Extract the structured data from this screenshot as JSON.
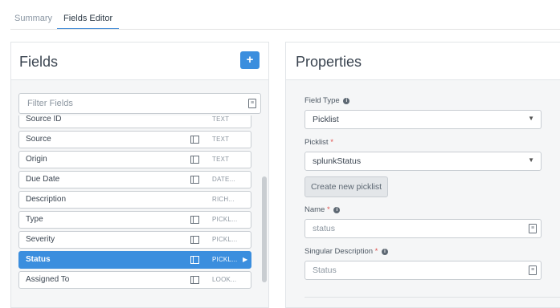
{
  "tabs": {
    "summary": "Summary",
    "fields_editor": "Fields Editor"
  },
  "fields": {
    "title": "Fields",
    "add_label": "+",
    "filter_placeholder": "Filter Fields",
    "rows": [
      {
        "name": "Source ID",
        "type": "TEXT",
        "icon": "table-icon",
        "has_icon": false
      },
      {
        "name": "Source",
        "type": "TEXT",
        "icon": "table-icon",
        "has_icon": true
      },
      {
        "name": "Origin",
        "type": "TEXT",
        "icon": "table-icon",
        "has_icon": true
      },
      {
        "name": "Due Date",
        "type": "DATE...",
        "icon": "table-icon",
        "has_icon": true
      },
      {
        "name": "Description",
        "type": "RICH...",
        "icon": "table-icon",
        "has_icon": false
      },
      {
        "name": "Type",
        "type": "PICKL...",
        "icon": "table-icon",
        "has_icon": true
      },
      {
        "name": "Severity",
        "type": "PICKL...",
        "icon": "table-icon",
        "has_icon": true
      },
      {
        "name": "Status",
        "type": "PICKL...",
        "icon": "table-icon",
        "has_icon": true,
        "selected": true
      },
      {
        "name": "Assigned To",
        "type": "LOOK...",
        "icon": "table-icon",
        "has_icon": true
      }
    ]
  },
  "properties": {
    "title": "Properties",
    "field_type_label": "Field Type",
    "field_type_value": "Picklist",
    "picklist_label": "Picklist",
    "picklist_value": "splunkStatus",
    "create_picklist_label": "Create new picklist",
    "name_label": "Name",
    "name_value": "status",
    "singular_label": "Singular Description",
    "singular_value": "Status",
    "required_mark": "*",
    "info_glyph": "i"
  },
  "colors": {
    "accent": "#3b8ede",
    "required": "#e0504d"
  }
}
